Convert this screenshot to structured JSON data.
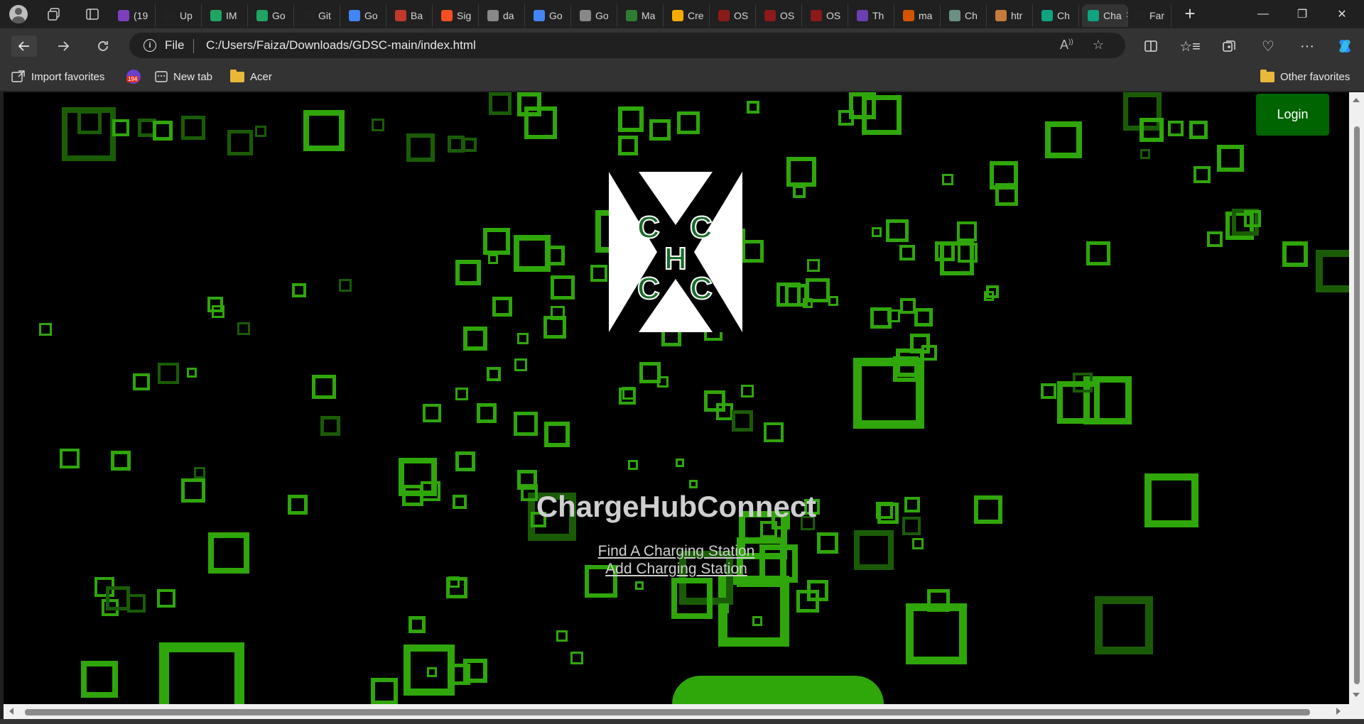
{
  "browser": {
    "tabs": [
      {
        "label": "(19",
        "icon": "badge-196-icon",
        "color": "#7b3fbf"
      },
      {
        "label": "Up",
        "icon": "github-icon",
        "color": "#222222"
      },
      {
        "label": "IM",
        "icon": "drive-icon",
        "color": "#1fa463"
      },
      {
        "label": "Go",
        "icon": "drive-icon",
        "color": "#1fa463"
      },
      {
        "label": "Git",
        "icon": "github-icon",
        "color": "#222222"
      },
      {
        "label": "Go",
        "icon": "google-icon",
        "color": "#4285f4"
      },
      {
        "label": "Ba",
        "icon": "pdf-icon",
        "color": "#c0392b"
      },
      {
        "label": "Sig",
        "icon": "microsoft-icon",
        "color": "#f25022"
      },
      {
        "label": "da",
        "icon": "file-icon",
        "color": "#888888"
      },
      {
        "label": "Go",
        "icon": "google-icon",
        "color": "#4285f4"
      },
      {
        "label": "Go",
        "icon": "file-icon",
        "color": "#888888"
      },
      {
        "label": "Ma",
        "icon": "m-icon",
        "color": "#2e7d32"
      },
      {
        "label": "Cre",
        "icon": "colab-icon",
        "color": "#f9ab00"
      },
      {
        "label": "OS",
        "icon": "shield-icon",
        "color": "#8b1a1a"
      },
      {
        "label": "OS",
        "icon": "shield-icon",
        "color": "#8b1a1a"
      },
      {
        "label": "OS",
        "icon": "shield-icon",
        "color": "#8b1a1a"
      },
      {
        "label": "Th",
        "icon": "purple-icon",
        "color": "#6a3fb0"
      },
      {
        "label": "ma",
        "icon": "grid-icon",
        "color": "#d35400"
      },
      {
        "label": "Ch",
        "icon": "chatgpt-icon",
        "color": "#6b8f84"
      },
      {
        "label": "htr",
        "icon": "feather-icon",
        "color": "#c77b3b"
      },
      {
        "label": "Ch",
        "icon": "chatgpt-icon",
        "color": "#10a37f"
      },
      {
        "label": "Cha",
        "icon": "chatgpt-icon",
        "color": "#10a37f",
        "active": true
      },
      {
        "label": "Far",
        "icon": "github-icon",
        "color": "#222222"
      }
    ],
    "address": {
      "scheme": "File",
      "url": "C:/Users/Faiza/Downloads/GDSC-main/index.html"
    },
    "favorites": {
      "import": "Import favorites",
      "badge": "194",
      "new_tab": "New tab",
      "acer": "Acer",
      "other": "Other favorites"
    }
  },
  "page": {
    "login_label": "Login",
    "logo_letters": [
      "C",
      "C",
      "H",
      "C",
      "C"
    ],
    "title": "ChargeHubConnect",
    "links": [
      "Find A Charging Station",
      "Add Charging Station"
    ],
    "colors": {
      "background": "#000000",
      "square_bright": "#2fa60a",
      "square_dim": "#1a5c06",
      "login_button": "#006400",
      "logo_text": "#1a6b2a"
    }
  }
}
